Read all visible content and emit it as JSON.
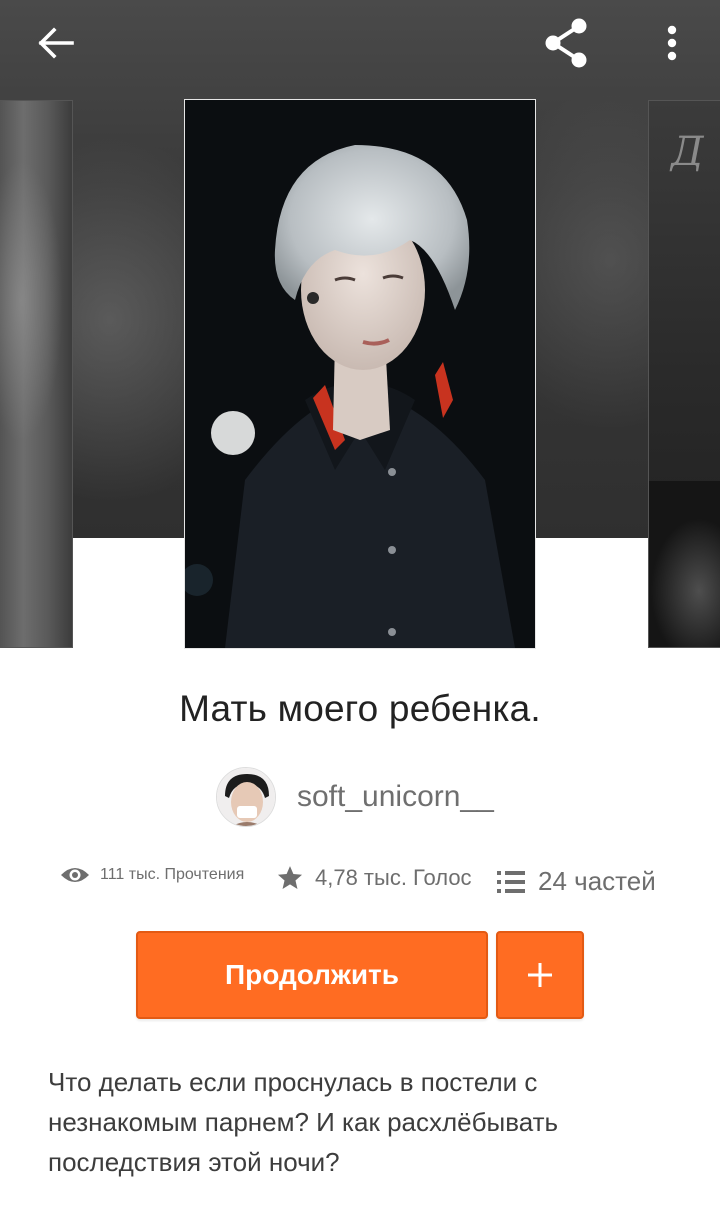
{
  "header": {
    "back_icon": "arrow-left-icon",
    "share_icon": "share-icon",
    "more_icon": "more-vertical-icon"
  },
  "carousel": {
    "covers": [
      "previous-cover",
      "current-cover",
      "next-cover"
    ]
  },
  "story": {
    "title": "Мать моего ребенка.",
    "author": "soft_unicorn__",
    "stats": {
      "reads": "111 тыс. Прочтения",
      "votes": "4,78 тыс. Голос",
      "parts": "24 частей"
    },
    "continue_label": "Продолжить",
    "add_label": "+",
    "description": "Что делать если проснулась в постели с незнакомым парнем? И как расхлёбывать последствия этой ночи?"
  },
  "colors": {
    "accent": "#ff6c22",
    "accent_border": "#e35a14",
    "text_primary": "#222222",
    "text_secondary": "#6e6e6e"
  }
}
